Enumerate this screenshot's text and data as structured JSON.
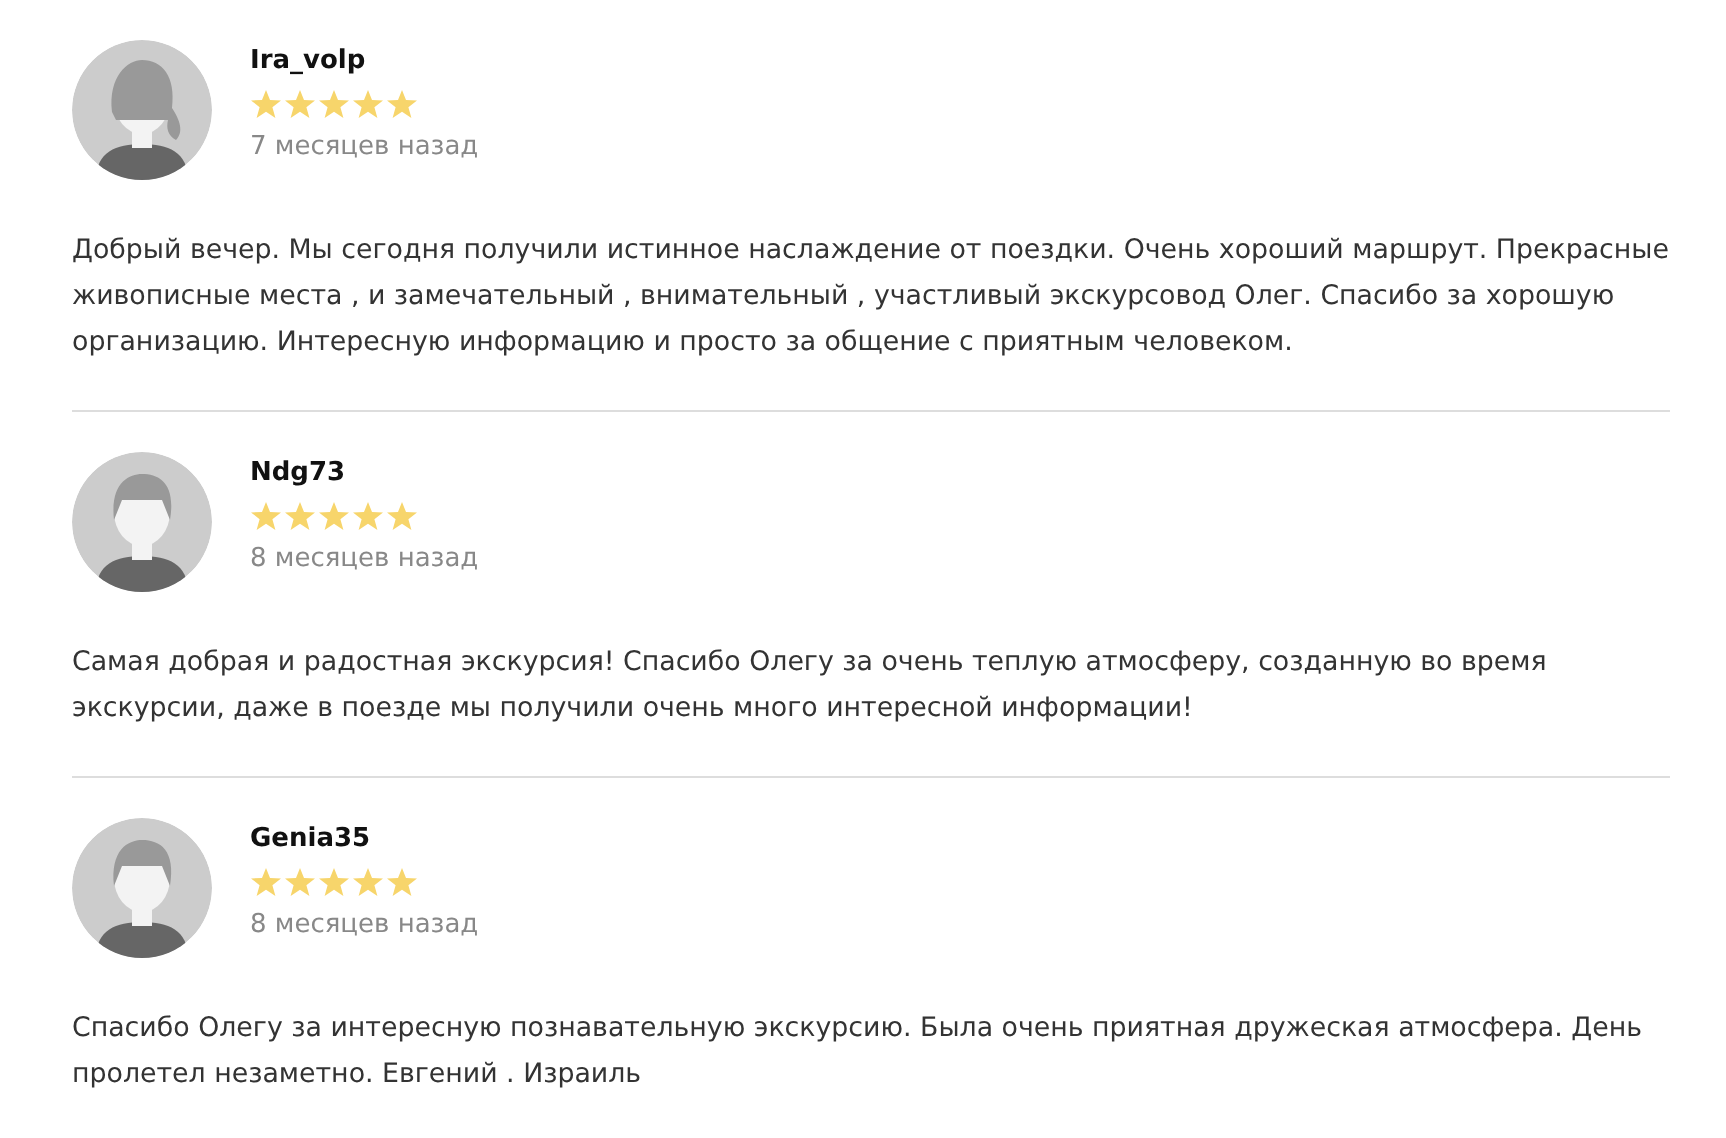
{
  "reviews": [
    {
      "author": "Ira_volp",
      "kind": "female",
      "stars": 5,
      "date": "7 месяцев назад",
      "text": "Добрый вечер. Мы сегодня получили истинное наслаждение от поездки. Очень хороший маршрут. Прекрасные живописные места , и замечательный , внимательный , участливый экскурсовод Олег. Спасибо за хорошую организацию. Интересную информацию и просто за общение с приятным человеком."
    },
    {
      "author": "Ndg73",
      "kind": "male",
      "stars": 5,
      "date": "8 месяцев назад",
      "text": "Самая добрая и радостная экскурсия! Спасибо Олегу за очень теплую атмосферу, созданную во время экскурсии, даже в поезде мы получили очень много интересной информации!"
    },
    {
      "author": "Genia35",
      "kind": "male",
      "stars": 5,
      "date": "8 месяцев назад",
      "text": "Спасибо Олегу за интересную познавательную экскурсию. Была очень приятная дружеская атмосфера. День пролетел незаметно. Евгений . Израиль"
    }
  ]
}
